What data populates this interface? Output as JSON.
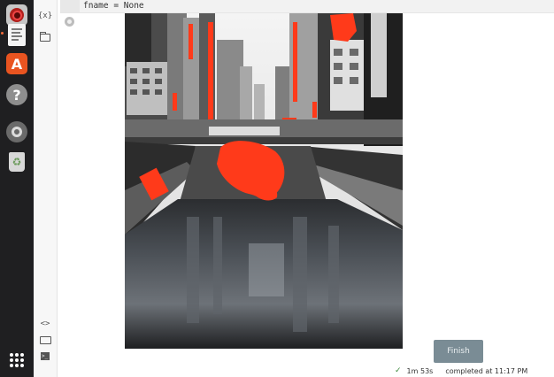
{
  "launcher": {
    "items": [
      {
        "name": "rhythmbox-icon"
      },
      {
        "name": "libreoffice-writer-icon"
      },
      {
        "name": "ubuntu-software-icon",
        "glyph": "A"
      },
      {
        "name": "help-icon",
        "glyph": "?"
      },
      {
        "name": "settings-icon"
      },
      {
        "name": "trash-icon",
        "glyph": "♻"
      },
      {
        "name": "show-applications-icon"
      }
    ]
  },
  "rail": {
    "variables_glyph": "{x}",
    "code_glyph": "<>",
    "terminal_glyph": ">_"
  },
  "cell": {
    "code": "fname = None"
  },
  "output": {
    "description_colors": {
      "accent_blob": "#ff3a1a"
    }
  },
  "footer": {
    "finish_label": "Finish",
    "check": "✓",
    "duration": "1m 53s",
    "completed": "completed at 11:17 PM"
  },
  "colors": {
    "launcher_bg": "#1f1f21",
    "finish_bg": "#7a8c95",
    "check_green": "#3d8a3d"
  }
}
